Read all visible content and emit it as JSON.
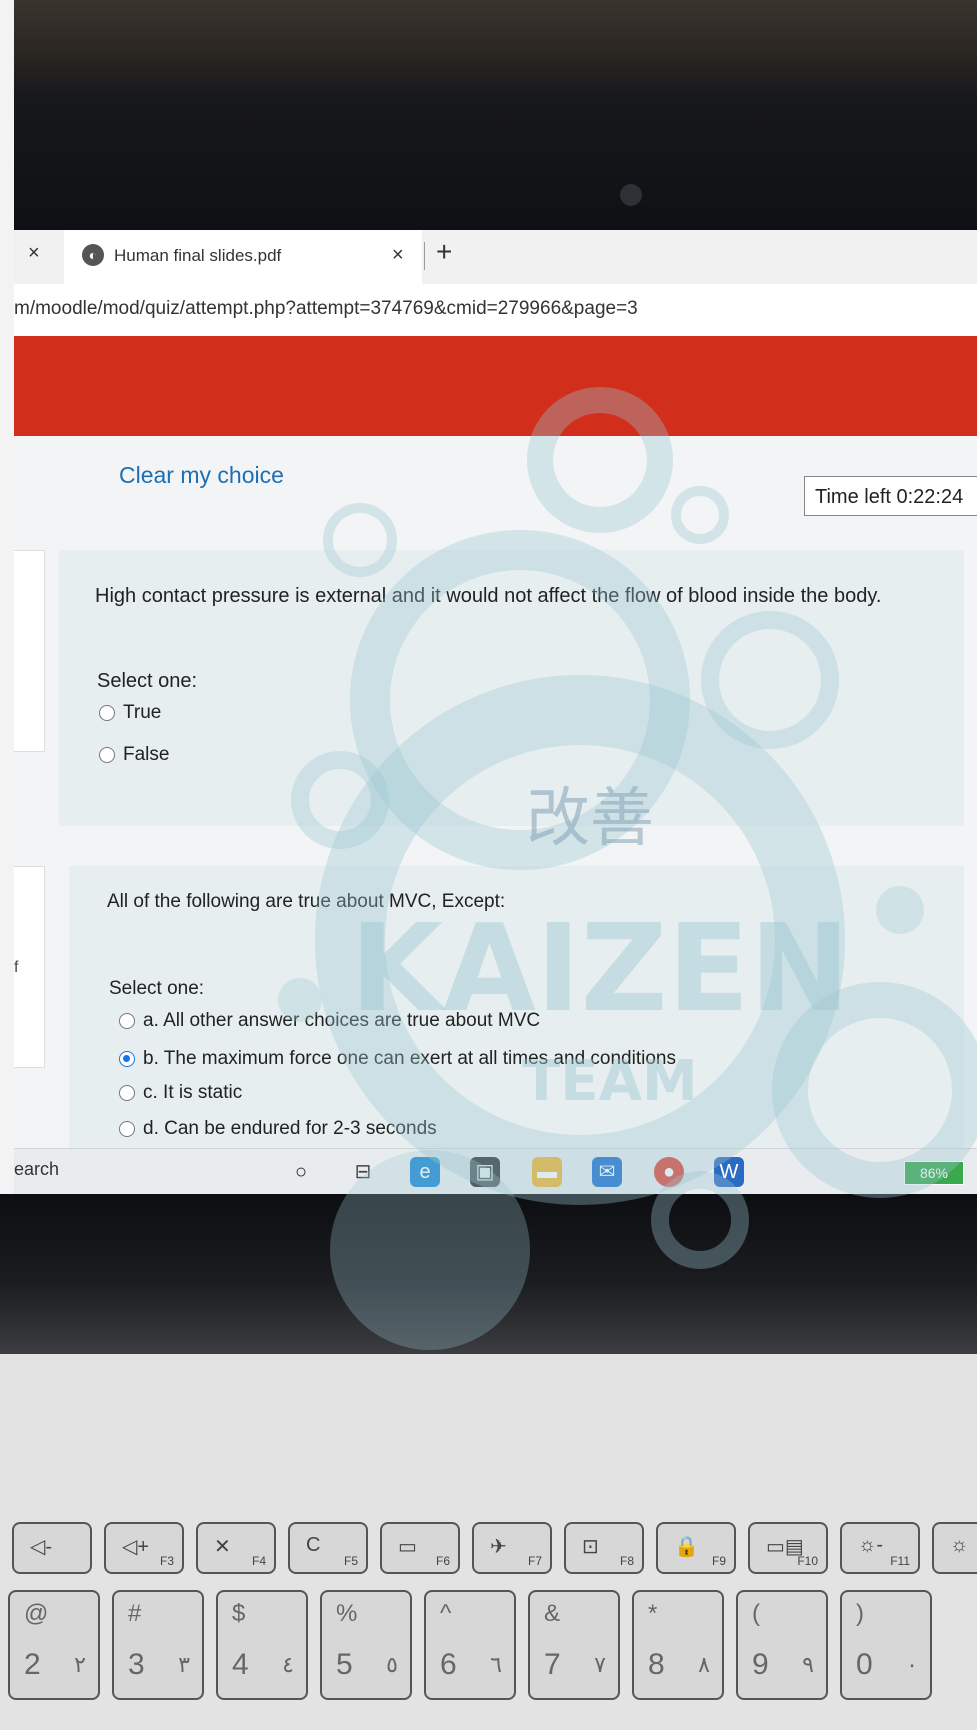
{
  "browser": {
    "prev_tab_close": "×",
    "active_tab": {
      "title": "Human final slides.pdf",
      "close": "×"
    },
    "new_tab": "+",
    "url": "m/moodle/mod/quiz/attempt.php?attempt=374769&cmid=279966&page=3"
  },
  "quiz": {
    "clear_choice": "Clear my choice",
    "timer": "Time left 0:22:24",
    "questions": [
      {
        "text": "High contact pressure is external and it would not affect the flow of blood inside the body.",
        "select_label": "Select one:",
        "options": [
          {
            "label": "True",
            "selected": false
          },
          {
            "label": "False",
            "selected": false
          }
        ]
      },
      {
        "text": "All of the following are true about MVC, Except:",
        "select_label": "Select one:",
        "side_letter": "f",
        "options": [
          {
            "label": "a. All other answer choices are true about MVC",
            "selected": false
          },
          {
            "label": "b. The maximum force one can exert at all times and conditions",
            "selected": true
          },
          {
            "label": "c. It is static",
            "selected": false
          },
          {
            "label": "d. Can be endured for 2-3 seconds",
            "selected": false
          }
        ]
      }
    ]
  },
  "taskbar": {
    "search": "earch",
    "icons": [
      "cortana-icon",
      "task-view-icon",
      "edge-icon",
      "store-icon",
      "file-explorer-icon",
      "mail-icon",
      "chrome-icon",
      "word-icon"
    ],
    "battery": "86%"
  },
  "watermark": {
    "chinese": "改善",
    "main": "KAIZEN",
    "sub": "TEAM"
  },
  "keyboard": {
    "fkeys": [
      {
        "main": "◁-",
        "sub": ""
      },
      {
        "main": "◁+",
        "sub": "F3"
      },
      {
        "main": "✕",
        "sub": "F4"
      },
      {
        "main": "C",
        "sub": "F5"
      },
      {
        "main": "▭",
        "sub": "F6"
      },
      {
        "main": "✈",
        "sub": "F7"
      },
      {
        "main": "⊡",
        "sub": "F8"
      },
      {
        "main": "🔒",
        "sub": "F9"
      },
      {
        "main": "▭▤",
        "sub": "F10"
      },
      {
        "main": "☼-",
        "sub": "F11"
      },
      {
        "main": "☼",
        "sub": ""
      }
    ],
    "numkeys": [
      {
        "top": "@",
        "bot": "2",
        "ar": "٢"
      },
      {
        "top": "#",
        "bot": "3",
        "ar": "٣"
      },
      {
        "top": "$",
        "bot": "4",
        "ar": "٤"
      },
      {
        "top": "%",
        "bot": "5",
        "ar": "٥"
      },
      {
        "top": "^",
        "bot": "6",
        "ar": "٦"
      },
      {
        "top": "&",
        "bot": "7",
        "ar": "٧"
      },
      {
        "top": "*",
        "bot": "8",
        "ar": "٨"
      },
      {
        "top": "(",
        "bot": "9",
        "ar": "٩"
      },
      {
        "top": ")",
        "bot": "0",
        "ar": "٠"
      }
    ]
  }
}
